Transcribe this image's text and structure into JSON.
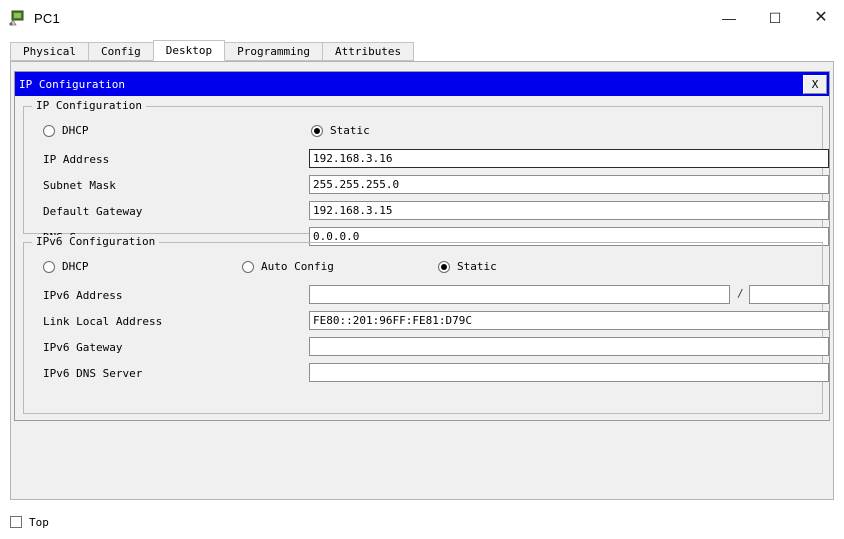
{
  "window": {
    "title": "PC1",
    "icon": "pc-device-icon",
    "controls": {
      "minimize": "—",
      "maximize": "☐",
      "close": "✕"
    }
  },
  "tabs": [
    {
      "label": "Physical",
      "active": false
    },
    {
      "label": "Config",
      "active": false
    },
    {
      "label": "Desktop",
      "active": true
    },
    {
      "label": "Programming",
      "active": false
    },
    {
      "label": "Attributes",
      "active": false
    }
  ],
  "dialog": {
    "title": "IP Configuration",
    "close_label": "X",
    "title_bar_color": "#0000ee"
  },
  "ipv4": {
    "legend": "IP Configuration",
    "mode_options": [
      {
        "label": "DHCP",
        "selected": false
      },
      {
        "label": "Static",
        "selected": true
      }
    ],
    "fields": [
      {
        "label": "IP Address",
        "value": "192.168.3.16",
        "focused": true
      },
      {
        "label": "Subnet Mask",
        "value": "255.255.255.0",
        "focused": false
      },
      {
        "label": "Default Gateway",
        "value": "192.168.3.15",
        "focused": false
      },
      {
        "label": "DNS Server",
        "value": "0.0.0.0",
        "focused": false
      }
    ]
  },
  "ipv6": {
    "legend": "IPv6 Configuration",
    "mode_options": [
      {
        "label": "DHCP",
        "selected": false
      },
      {
        "label": "Auto Config",
        "selected": false
      },
      {
        "label": "Static",
        "selected": true
      }
    ],
    "address_label": "IPv6 Address",
    "address_value": "",
    "prefix_separator": "/",
    "prefix_value": "",
    "fields": [
      {
        "label": "Link Local Address",
        "value": "FE80::201:96FF:FE81:D79C"
      },
      {
        "label": "IPv6 Gateway",
        "value": ""
      },
      {
        "label": "IPv6 DNS Server",
        "value": ""
      }
    ]
  },
  "footer": {
    "top_checkbox_label": "Top",
    "top_checkbox_checked": false
  }
}
